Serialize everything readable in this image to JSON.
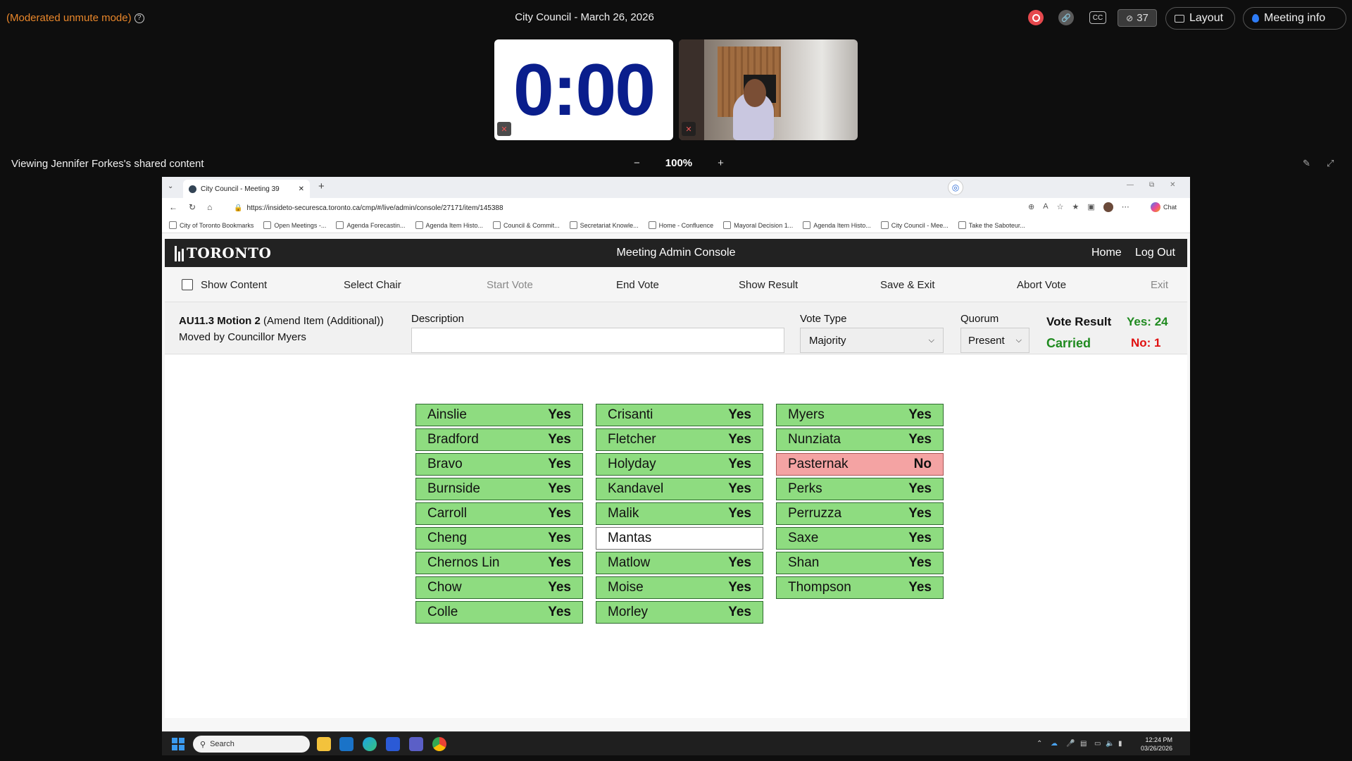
{
  "zoom": {
    "mode_text": "(Moderated unmute mode)",
    "meeting_title": "City Council - March 26, 2026",
    "participants_count": "37",
    "layout_label": "Layout",
    "meeting_info_label": "Meeting info",
    "timer": "0:00",
    "viewing_text": "Viewing Jennifer Forkes's shared content",
    "zoom_level": "100%",
    "zoom_minus": "−",
    "zoom_plus": "+"
  },
  "browser": {
    "tab_title": "City Council - Meeting 39",
    "url": "https://insideto-securesca.toronto.ca/cmp/#/live/admin/console/27171/item/145388",
    "chat_label": "Chat",
    "bookmarks": [
      "City of Toronto Bookmarks",
      "Open Meetings -...",
      "Agenda Forecastin...",
      "Agenda Item Histo...",
      "Council & Commit...",
      "Secretariat Knowle...",
      "Home - Confluence",
      "Mayoral Decision 1...",
      "Agenda Item Histo...",
      "City Council - Mee...",
      "Take the Saboteur..."
    ]
  },
  "app": {
    "logo_text": "TORONTO",
    "title": "Meeting Admin Console",
    "home": "Home",
    "logout": "Log Out",
    "toolbar": {
      "show_content": "Show Content",
      "select_chair": "Select Chair",
      "start_vote": "Start Vote",
      "end_vote": "End Vote",
      "show_result": "Show Result",
      "save_exit": "Save & Exit",
      "abort_vote": "Abort Vote",
      "exit": "Exit"
    },
    "motion": {
      "id": "AU11.3 Motion 2",
      "type": "(Amend Item (Additional))",
      "moved_by": "Moved by Councillor Myers",
      "description_label": "Description",
      "description_value": "",
      "vote_type_label": "Vote Type",
      "vote_type_value": "Majority",
      "quorum_label": "Quorum",
      "quorum_value": "Present",
      "vote_result_label": "Vote Result",
      "vote_result_status": "Carried",
      "yes_count": "Yes: 24",
      "no_count": "No: 1"
    },
    "votes": [
      [
        {
          "name": "Ainslie",
          "vote": "Yes"
        },
        {
          "name": "Bradford",
          "vote": "Yes"
        },
        {
          "name": "Bravo",
          "vote": "Yes"
        },
        {
          "name": "Burnside",
          "vote": "Yes"
        },
        {
          "name": "Carroll",
          "vote": "Yes"
        },
        {
          "name": "Cheng",
          "vote": "Yes"
        },
        {
          "name": "Chernos Lin",
          "vote": "Yes"
        },
        {
          "name": "Chow",
          "vote": "Yes"
        },
        {
          "name": "Colle",
          "vote": "Yes"
        }
      ],
      [
        {
          "name": "Crisanti",
          "vote": "Yes"
        },
        {
          "name": "Fletcher",
          "vote": "Yes"
        },
        {
          "name": "Holyday",
          "vote": "Yes"
        },
        {
          "name": "Kandavel",
          "vote": "Yes"
        },
        {
          "name": "Malik",
          "vote": "Yes"
        },
        {
          "name": "Mantas",
          "vote": ""
        },
        {
          "name": "Matlow",
          "vote": "Yes"
        },
        {
          "name": "Moise",
          "vote": "Yes"
        },
        {
          "name": "Morley",
          "vote": "Yes"
        }
      ],
      [
        {
          "name": "Myers",
          "vote": "Yes"
        },
        {
          "name": "Nunziata",
          "vote": "Yes"
        },
        {
          "name": "Pasternak",
          "vote": "No"
        },
        {
          "name": "Perks",
          "vote": "Yes"
        },
        {
          "name": "Perruzza",
          "vote": "Yes"
        },
        {
          "name": "Saxe",
          "vote": "Yes"
        },
        {
          "name": "Shan",
          "vote": "Yes"
        },
        {
          "name": "Thompson",
          "vote": "Yes"
        }
      ]
    ]
  },
  "taskbar": {
    "search_placeholder": "Search",
    "time": "12:24 PM",
    "date": "03/26/2026"
  },
  "colors": {
    "yes_bg": "#8edc80",
    "no_bg": "#f4a3a3",
    "carried": "#1f8a1f",
    "no_count": "#e01010",
    "timer": "#0a1e8c"
  }
}
